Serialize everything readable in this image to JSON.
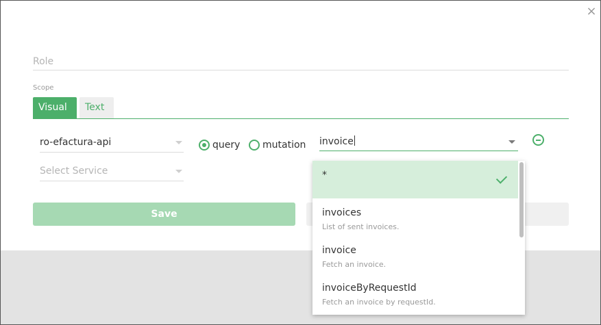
{
  "close_icon": "×",
  "role": {
    "placeholder": "Role",
    "value": ""
  },
  "scope": {
    "label": "Scope",
    "tabs": [
      {
        "label": "Visual",
        "active": true
      },
      {
        "label": "Text",
        "active": false
      }
    ]
  },
  "rule": {
    "api_select": {
      "value": "ro-efactura-api"
    },
    "service_select": {
      "placeholder": "Select Service"
    },
    "operation_type": {
      "options": [
        {
          "label": "query",
          "checked": true
        },
        {
          "label": "mutation",
          "checked": false
        }
      ]
    },
    "operation_input": {
      "value": "invoice"
    }
  },
  "buttons": {
    "save": "Save",
    "cancel": ""
  },
  "dropdown": {
    "items": [
      {
        "title": "*",
        "description": "",
        "selected": true
      },
      {
        "title": "invoices",
        "description": "List of sent invoices.",
        "selected": false
      },
      {
        "title": "invoice",
        "description": "Fetch an invoice.",
        "selected": false
      },
      {
        "title": "invoiceByRequestId",
        "description": "Fetch an invoice by requestId.",
        "selected": false
      }
    ]
  },
  "colors": {
    "accent": "#4caf6a",
    "selected_bg": "#d6eedb",
    "save_disabled": "#a6d9b3"
  }
}
